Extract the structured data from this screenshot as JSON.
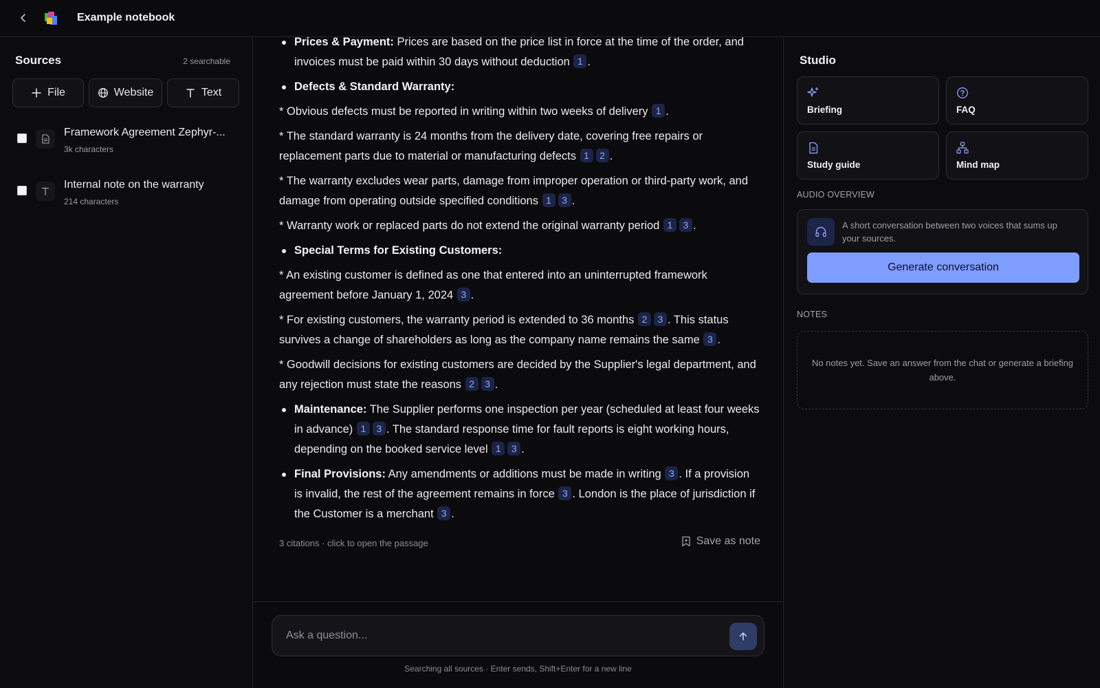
{
  "header": {
    "title": "Example notebook"
  },
  "sources": {
    "title": "Sources",
    "searchable": "2 searchable",
    "add_buttons": [
      "File",
      "Website",
      "Text"
    ],
    "items": [
      {
        "name": "Framework Agreement Zephyr-...",
        "meta": "3k characters",
        "icon": "document-icon"
      },
      {
        "name": "Internal note on the warranty",
        "meta": "214 characters",
        "icon": "text-icon"
      }
    ]
  },
  "chat": {
    "p1_head": "Prices & Payment:",
    "p1_text": " Prices are based on the price list in force at the time of the order, and invoices must be paid within 30 days without deduction",
    "p2_head": "Defects & Standard Warranty:",
    "p3_text": "* Obvious defects must be reported in writing within two weeks of delivery",
    "p4_text": "* The standard warranty is 24 months from the delivery date, covering free repairs or replacement parts due to material or manufacturing defects",
    "p5_text": "* The warranty excludes wear parts, damage from improper operation or third-party work, and damage from operating outside specified conditions",
    "p6_text": "* Warranty work or replaced parts do not extend the original warranty period",
    "p7_head": "Special Terms for Existing Customers:",
    "p8_text": "* An existing customer is defined as one that entered into an uninterrupted framework agreement before January 1, 2024",
    "p9_text_a": "* For existing customers, the warranty period is extended to 36 months",
    "p9_text_b": ". This status survives a change of shareholders as long as the company name remains the same",
    "p10_text": "* Goodwill decisions for existing customers are decided by the Supplier's legal department, and any rejection must state the reasons",
    "p11_head": "Maintenance:",
    "p11_text_a": " The Supplier performs one inspection per year (scheduled at least four weeks in advance)",
    "p11_text_b": ". The standard response time for fault reports is eight working hours, depending on the booked service level",
    "p12_head": "Final Provisions:",
    "p12_text_a": " Any amendments or additions must be made in writing",
    "p12_text_b": ". If a provision is invalid, the rest of the agreement remains in force",
    "p12_text_c": ". London is the place of jurisdiction if the Customer is a merchant",
    "period": ".",
    "c1": "1",
    "c2": "2",
    "c3": "3",
    "citations_note": "3 citations · click to open the passage",
    "save_note": "Save as note"
  },
  "composer": {
    "placeholder": "Ask a question...",
    "hint": "Searching all sources · Enter sends, Shift+Enter for a new line"
  },
  "studio": {
    "title": "Studio",
    "cards": [
      {
        "label": "Briefing",
        "icon": "sparkle-icon"
      },
      {
        "label": "FAQ",
        "icon": "question-icon"
      },
      {
        "label": "Study guide",
        "icon": "document-icon"
      },
      {
        "label": "Mind map",
        "icon": "mindmap-icon"
      }
    ],
    "audio_label": "AUDIO OVERVIEW",
    "audio_desc": "A short conversation between two voices that sums up your sources.",
    "audio_button": "Generate conversation",
    "notes_label": "NOTES",
    "notes_empty": "No notes yet. Save an answer from the chat or generate a briefing above."
  },
  "colors": {
    "accent": "#7f9cff",
    "citation_bg": "#1c2547",
    "citation_text": "#8fa4ff",
    "background": "#0b0b0e"
  }
}
